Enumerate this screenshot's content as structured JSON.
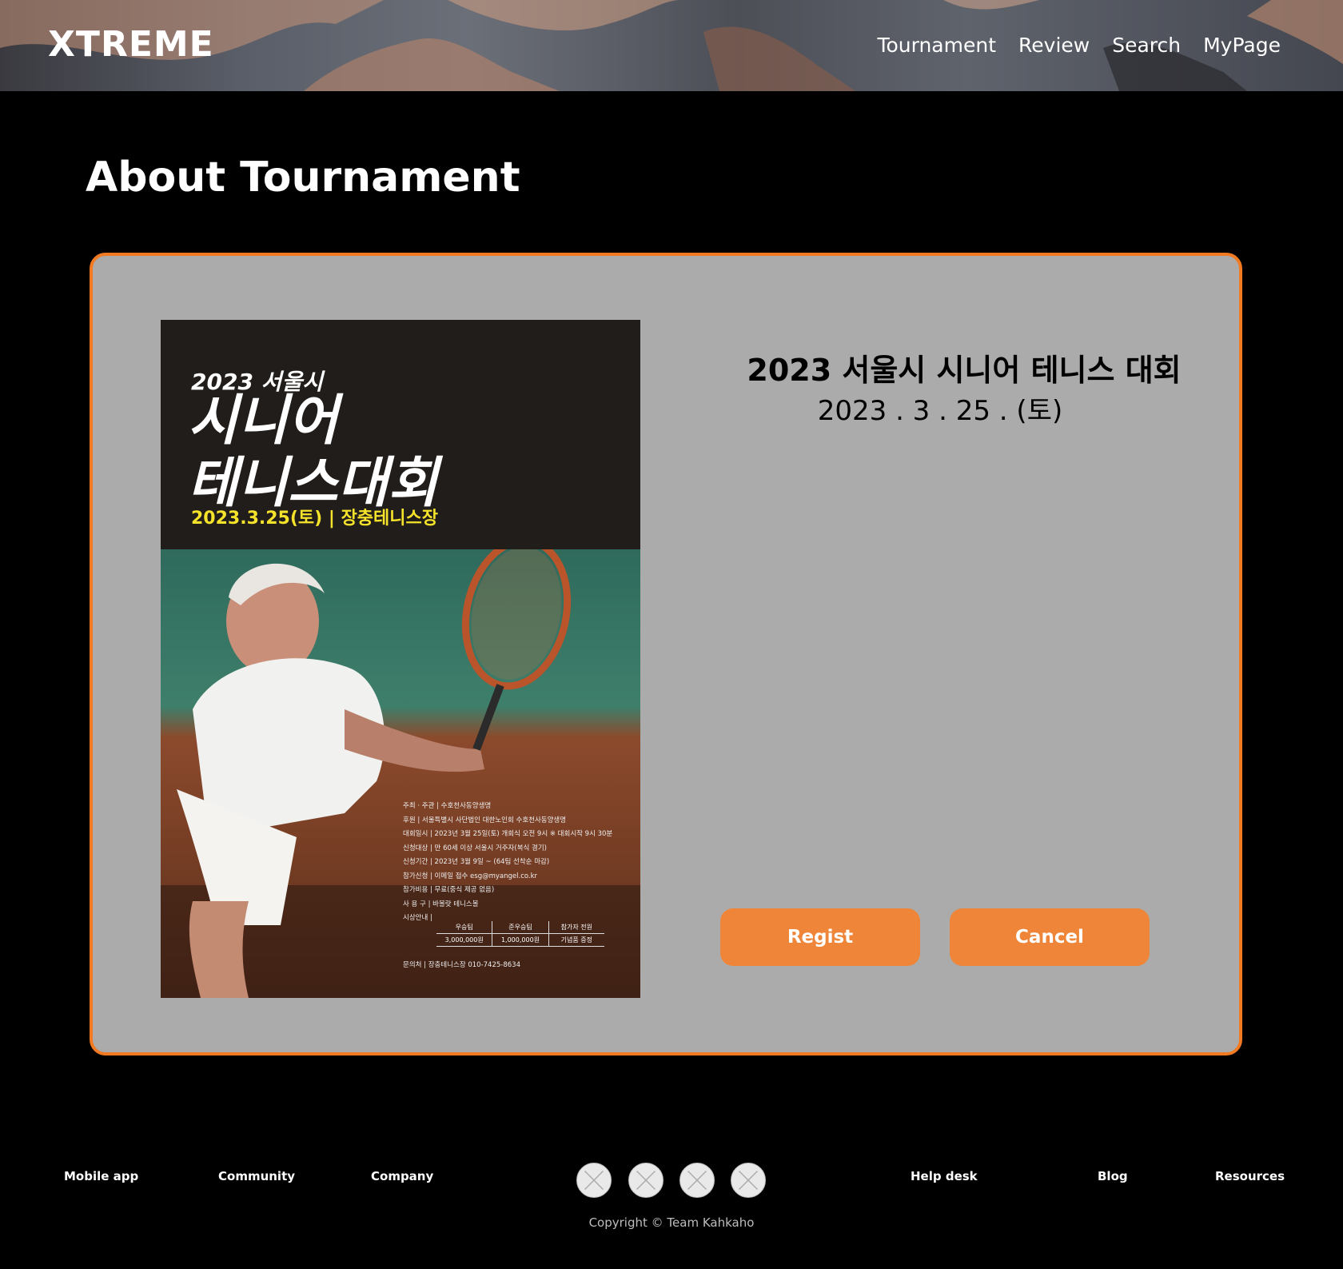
{
  "header": {
    "logo": "XTREME",
    "nav": [
      "Tournament",
      "Review",
      "Search",
      "MyPage"
    ]
  },
  "page_title": "About Tournament",
  "tournament": {
    "name": "2023 서울시 시니어 테니스 대회",
    "date": "2023 . 3 . 25 . (토)",
    "poster": {
      "year_city": "2023 서울시",
      "title_line1": "시니어",
      "title_line2": "테니스대회",
      "date_venue": "2023.3.25(토) | 장충테니스장",
      "info": [
        "주최 · 주관 | 수호천사동양생명",
        "후원 | 서울특별시  사단법인 대한노인회  수호천사동양생명",
        "대회일시 | 2023년 3월 25일(토) 개회식 오전 9시 ※ 대회시작 9시 30분",
        "신청대상 | 만 60세 이상 서울시 거주자(복식 경기)",
        "신청기간 | 2023년 3월 9일 ~ (64팀 선착순 마감)",
        "참가신청 | 이메일 접수 esg@myangel.co.kr",
        "참가비용 | 무료(중식 제공 없음)",
        "사 용 구 | 바볼랏 테니스볼",
        "시상안내 |"
      ],
      "prize_headers": [
        "우승팀",
        "준우승팀",
        "참가자 전원"
      ],
      "prize_values": [
        "3,000,000원",
        "1,000,000원",
        "기념품 증정"
      ],
      "contact": "문의처 | 장충테니스장  010-7425-8634"
    }
  },
  "buttons": {
    "regist": "Regist",
    "cancel": "Cancel"
  },
  "footer": {
    "links_left": [
      "Mobile app",
      "Community",
      "Company"
    ],
    "links_right": [
      "Help desk",
      "Blog",
      "Resources"
    ],
    "social_icons": [
      "social-icon-1",
      "social-icon-2",
      "social-icon-3",
      "social-icon-4"
    ],
    "copyright": "Copyright © Team Kahkaho"
  },
  "colors": {
    "accent": "#f27a23",
    "button": "#ee8538",
    "card_bg": "#ababab",
    "poster_highlight": "#f5e22a"
  }
}
